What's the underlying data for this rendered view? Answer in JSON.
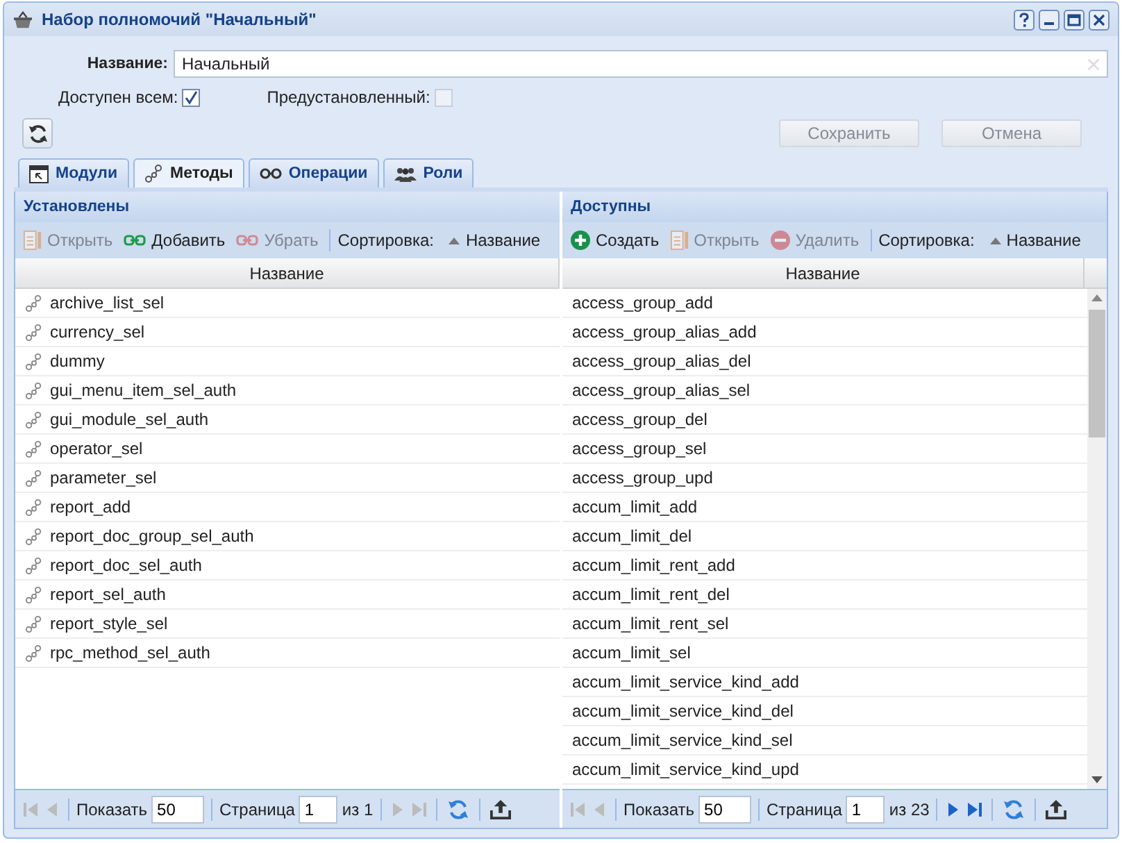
{
  "window": {
    "title": "Набор полномочий \"Начальный\""
  },
  "form": {
    "name_label": "Название:",
    "name_value": "Начальный",
    "checkboxes": [
      {
        "label": "Доступен всем:",
        "checked": true,
        "disabled": false
      },
      {
        "label": "Предустановленный:",
        "checked": false,
        "disabled": true
      }
    ],
    "buttons": [
      {
        "label": "Сохранить",
        "disabled": true
      },
      {
        "label": "Отмена",
        "disabled": true
      }
    ]
  },
  "tabs": [
    {
      "label": "Модули",
      "kind": "modules",
      "selected": false
    },
    {
      "label": "Методы",
      "kind": "methods",
      "selected": true
    },
    {
      "label": "Операции",
      "kind": "operations",
      "selected": false
    },
    {
      "label": "Роли",
      "kind": "roles",
      "selected": false
    }
  ],
  "panels": [
    {
      "title": "Установлены",
      "row_icons": true,
      "scrollbar": false,
      "toolbar": [
        {
          "kind": "open",
          "label": "Открыть",
          "disabled": true
        },
        {
          "kind": "add",
          "label": "Добавить",
          "disabled": false
        },
        {
          "kind": "remove",
          "label": "Убрать",
          "disabled": true
        }
      ],
      "sort_label": "Сортировка:",
      "sort_value": "Название",
      "column": "Название",
      "rows": [
        "archive_list_sel",
        "currency_sel",
        "dummy",
        "gui_menu_item_sel_auth",
        "gui_module_sel_auth",
        "operator_sel",
        "parameter_sel",
        "report_add",
        "report_doc_group_sel_auth",
        "report_doc_sel_auth",
        "report_sel_auth",
        "report_style_sel",
        "rpc_method_sel_auth"
      ],
      "pager": {
        "show_label": "Показать",
        "page_size": "50",
        "page_label": "Страница",
        "page": "1",
        "of_text": "из 1",
        "next_enabled": false
      }
    },
    {
      "title": "Доступны",
      "row_icons": false,
      "scrollbar": true,
      "toolbar": [
        {
          "kind": "create",
          "label": "Создать",
          "disabled": false
        },
        {
          "kind": "open",
          "label": "Открыть",
          "disabled": true
        },
        {
          "kind": "delete",
          "label": "Удалить",
          "disabled": true
        }
      ],
      "sort_label": "Сортировка:",
      "sort_value": "Название",
      "column": "Название",
      "rows": [
        "access_group_add",
        "access_group_alias_add",
        "access_group_alias_del",
        "access_group_alias_sel",
        "access_group_del",
        "access_group_sel",
        "access_group_upd",
        "accum_limit_add",
        "accum_limit_del",
        "accum_limit_rent_add",
        "accum_limit_rent_del",
        "accum_limit_rent_sel",
        "accum_limit_sel",
        "accum_limit_service_kind_add",
        "accum_limit_service_kind_del",
        "accum_limit_service_kind_sel",
        "accum_limit_service_kind_upd"
      ],
      "pager": {
        "show_label": "Показать",
        "page_size": "50",
        "page_label": "Страница",
        "page": "1",
        "of_text": "из 23",
        "next_enabled": true
      }
    }
  ]
}
